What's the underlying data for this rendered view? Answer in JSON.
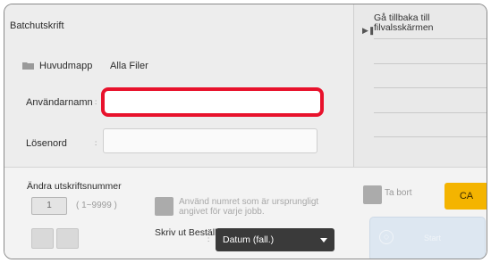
{
  "header": {
    "title": "Batchutskrift"
  },
  "folder": {
    "label": "Huvudmapp",
    "value": "Alla Filer",
    "icon": "folder-icon"
  },
  "form": {
    "username_label": "Användarnamn",
    "username_value": "",
    "password_label": "Lösenord",
    "password_value": "",
    "colon": ":"
  },
  "side": {
    "back_label": "Gå tillbaka till filvalsskärmen",
    "back_icon": "play-arrow-icon"
  },
  "print_options": {
    "change_label": "Ändra utskriftsnummer",
    "number_value": "1",
    "range": "( 1~9999 )",
    "original_number_label": "Använd numret som är ursprungligt angivet för varje jobb.",
    "delete_label": "Ta bort",
    "order_label": "Skriv ut Beställning",
    "order_value": "Datum (fall.)"
  },
  "buttons": {
    "ca": "CA",
    "start": "Start"
  },
  "colors": {
    "highlight": "#e8122c",
    "ca": "#f4b400",
    "dropdown": "#3a3a3a"
  }
}
